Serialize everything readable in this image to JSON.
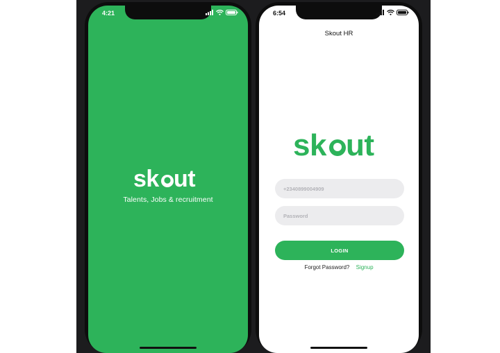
{
  "splash_screen": {
    "status_time": "4:21",
    "tagline": "Talents, Jobs & recruitment",
    "logo_word": "skout",
    "background": "#2db35a"
  },
  "login_screen": {
    "status_time": "6:54",
    "nav_title": "Skout HR",
    "logo_word": "skout",
    "phone_placeholder": "+2340899004909",
    "password_placeholder": "Password",
    "login_label": "LOGIN",
    "forgot_label": "Forgot Password?",
    "signup_label": "Signup",
    "accent": "#2db35a"
  },
  "icons": {
    "signal": "signal-icon",
    "wifi": "wifi-icon",
    "battery": "battery-icon"
  }
}
